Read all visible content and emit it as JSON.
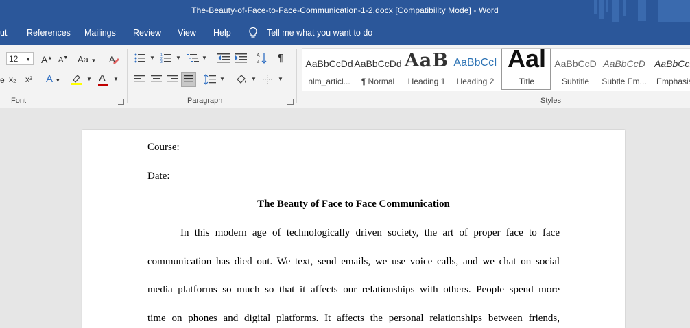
{
  "window": {
    "title": "The-Beauty-of-Face-to-Face-Communication-1-2.docx [Compatibility Mode]  -  Word"
  },
  "menu": {
    "tabs": [
      "ut",
      "References",
      "Mailings",
      "Review",
      "View",
      "Help"
    ],
    "tell_me": "Tell me what you want to do"
  },
  "ribbon": {
    "font": {
      "size": "12",
      "grow": "A",
      "shrink": "A",
      "case": "Aa",
      "subscript": "x₂",
      "superscript": "x²",
      "text_effects": "A",
      "font_color": "A",
      "label": "Font"
    },
    "paragraph": {
      "label": "Paragraph"
    },
    "styles": {
      "label": "Styles",
      "items": [
        {
          "preview": "AaBbCcDd",
          "label": "nlm_articl..."
        },
        {
          "preview": "AaBbCcDd",
          "label": "¶ Normal"
        },
        {
          "preview": "AaB",
          "label": "Heading 1"
        },
        {
          "preview": "AaBbCcI",
          "label": "Heading 2"
        },
        {
          "preview": "Aal",
          "label": "Title"
        },
        {
          "preview": "AaBbCcD",
          "label": "Subtitle"
        },
        {
          "preview": "AaBbCcD",
          "label": "Subtle Em..."
        },
        {
          "preview": "AaBbCcL",
          "label": "Emphasis"
        }
      ]
    }
  },
  "document": {
    "course": "Course:",
    "date": "Date:",
    "title": "The Beauty of Face to Face Communication",
    "lines": [
      "In this modern age of technologically driven society, the art of proper face to face",
      "communication has died out. We text,   send emails, we use voice calls, and we chat on social",
      "media platforms so much so that it affects our relationships with others. People spend more",
      "time on phones and digital platforms. It affects the personal relationships between friends,"
    ]
  },
  "colors": {
    "accent": "#2b579a",
    "ribbon": "#f3f3f3",
    "canvas": "#e6e6e6",
    "highlight": "#ffff00",
    "font_color_red": "#c00000",
    "text_effects_blue": "#2f6fc2"
  }
}
